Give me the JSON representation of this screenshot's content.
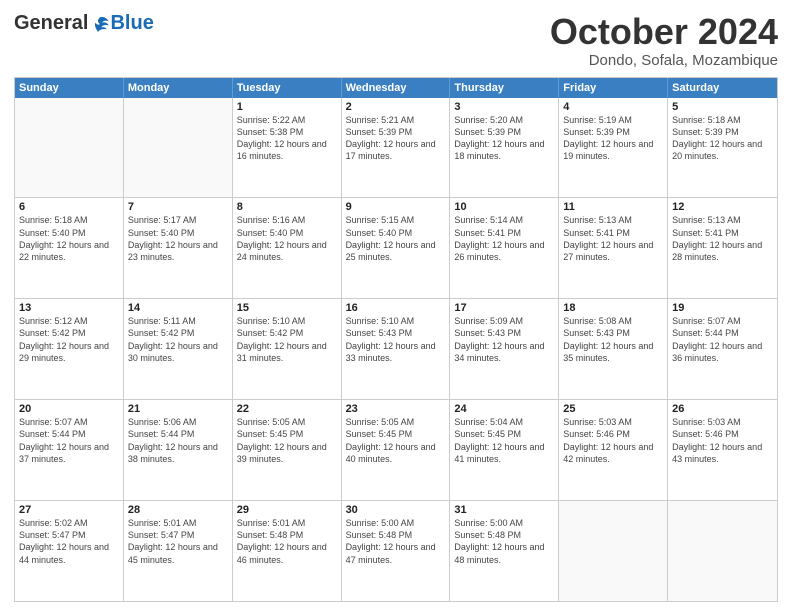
{
  "header": {
    "logo_general": "General",
    "logo_blue": "Blue",
    "month_title": "October 2024",
    "subtitle": "Dondo, Sofala, Mozambique"
  },
  "days_of_week": [
    "Sunday",
    "Monday",
    "Tuesday",
    "Wednesday",
    "Thursday",
    "Friday",
    "Saturday"
  ],
  "weeks": [
    [
      {
        "day": "",
        "empty": true
      },
      {
        "day": "",
        "empty": true
      },
      {
        "day": "1",
        "sunrise": "Sunrise: 5:22 AM",
        "sunset": "Sunset: 5:38 PM",
        "daylight": "Daylight: 12 hours and 16 minutes."
      },
      {
        "day": "2",
        "sunrise": "Sunrise: 5:21 AM",
        "sunset": "Sunset: 5:39 PM",
        "daylight": "Daylight: 12 hours and 17 minutes."
      },
      {
        "day": "3",
        "sunrise": "Sunrise: 5:20 AM",
        "sunset": "Sunset: 5:39 PM",
        "daylight": "Daylight: 12 hours and 18 minutes."
      },
      {
        "day": "4",
        "sunrise": "Sunrise: 5:19 AM",
        "sunset": "Sunset: 5:39 PM",
        "daylight": "Daylight: 12 hours and 19 minutes."
      },
      {
        "day": "5",
        "sunrise": "Sunrise: 5:18 AM",
        "sunset": "Sunset: 5:39 PM",
        "daylight": "Daylight: 12 hours and 20 minutes."
      }
    ],
    [
      {
        "day": "6",
        "sunrise": "Sunrise: 5:18 AM",
        "sunset": "Sunset: 5:40 PM",
        "daylight": "Daylight: 12 hours and 22 minutes."
      },
      {
        "day": "7",
        "sunrise": "Sunrise: 5:17 AM",
        "sunset": "Sunset: 5:40 PM",
        "daylight": "Daylight: 12 hours and 23 minutes."
      },
      {
        "day": "8",
        "sunrise": "Sunrise: 5:16 AM",
        "sunset": "Sunset: 5:40 PM",
        "daylight": "Daylight: 12 hours and 24 minutes."
      },
      {
        "day": "9",
        "sunrise": "Sunrise: 5:15 AM",
        "sunset": "Sunset: 5:40 PM",
        "daylight": "Daylight: 12 hours and 25 minutes."
      },
      {
        "day": "10",
        "sunrise": "Sunrise: 5:14 AM",
        "sunset": "Sunset: 5:41 PM",
        "daylight": "Daylight: 12 hours and 26 minutes."
      },
      {
        "day": "11",
        "sunrise": "Sunrise: 5:13 AM",
        "sunset": "Sunset: 5:41 PM",
        "daylight": "Daylight: 12 hours and 27 minutes."
      },
      {
        "day": "12",
        "sunrise": "Sunrise: 5:13 AM",
        "sunset": "Sunset: 5:41 PM",
        "daylight": "Daylight: 12 hours and 28 minutes."
      }
    ],
    [
      {
        "day": "13",
        "sunrise": "Sunrise: 5:12 AM",
        "sunset": "Sunset: 5:42 PM",
        "daylight": "Daylight: 12 hours and 29 minutes."
      },
      {
        "day": "14",
        "sunrise": "Sunrise: 5:11 AM",
        "sunset": "Sunset: 5:42 PM",
        "daylight": "Daylight: 12 hours and 30 minutes."
      },
      {
        "day": "15",
        "sunrise": "Sunrise: 5:10 AM",
        "sunset": "Sunset: 5:42 PM",
        "daylight": "Daylight: 12 hours and 31 minutes."
      },
      {
        "day": "16",
        "sunrise": "Sunrise: 5:10 AM",
        "sunset": "Sunset: 5:43 PM",
        "daylight": "Daylight: 12 hours and 33 minutes."
      },
      {
        "day": "17",
        "sunrise": "Sunrise: 5:09 AM",
        "sunset": "Sunset: 5:43 PM",
        "daylight": "Daylight: 12 hours and 34 minutes."
      },
      {
        "day": "18",
        "sunrise": "Sunrise: 5:08 AM",
        "sunset": "Sunset: 5:43 PM",
        "daylight": "Daylight: 12 hours and 35 minutes."
      },
      {
        "day": "19",
        "sunrise": "Sunrise: 5:07 AM",
        "sunset": "Sunset: 5:44 PM",
        "daylight": "Daylight: 12 hours and 36 minutes."
      }
    ],
    [
      {
        "day": "20",
        "sunrise": "Sunrise: 5:07 AM",
        "sunset": "Sunset: 5:44 PM",
        "daylight": "Daylight: 12 hours and 37 minutes."
      },
      {
        "day": "21",
        "sunrise": "Sunrise: 5:06 AM",
        "sunset": "Sunset: 5:44 PM",
        "daylight": "Daylight: 12 hours and 38 minutes."
      },
      {
        "day": "22",
        "sunrise": "Sunrise: 5:05 AM",
        "sunset": "Sunset: 5:45 PM",
        "daylight": "Daylight: 12 hours and 39 minutes."
      },
      {
        "day": "23",
        "sunrise": "Sunrise: 5:05 AM",
        "sunset": "Sunset: 5:45 PM",
        "daylight": "Daylight: 12 hours and 40 minutes."
      },
      {
        "day": "24",
        "sunrise": "Sunrise: 5:04 AM",
        "sunset": "Sunset: 5:45 PM",
        "daylight": "Daylight: 12 hours and 41 minutes."
      },
      {
        "day": "25",
        "sunrise": "Sunrise: 5:03 AM",
        "sunset": "Sunset: 5:46 PM",
        "daylight": "Daylight: 12 hours and 42 minutes."
      },
      {
        "day": "26",
        "sunrise": "Sunrise: 5:03 AM",
        "sunset": "Sunset: 5:46 PM",
        "daylight": "Daylight: 12 hours and 43 minutes."
      }
    ],
    [
      {
        "day": "27",
        "sunrise": "Sunrise: 5:02 AM",
        "sunset": "Sunset: 5:47 PM",
        "daylight": "Daylight: 12 hours and 44 minutes."
      },
      {
        "day": "28",
        "sunrise": "Sunrise: 5:01 AM",
        "sunset": "Sunset: 5:47 PM",
        "daylight": "Daylight: 12 hours and 45 minutes."
      },
      {
        "day": "29",
        "sunrise": "Sunrise: 5:01 AM",
        "sunset": "Sunset: 5:48 PM",
        "daylight": "Daylight: 12 hours and 46 minutes."
      },
      {
        "day": "30",
        "sunrise": "Sunrise: 5:00 AM",
        "sunset": "Sunset: 5:48 PM",
        "daylight": "Daylight: 12 hours and 47 minutes."
      },
      {
        "day": "31",
        "sunrise": "Sunrise: 5:00 AM",
        "sunset": "Sunset: 5:48 PM",
        "daylight": "Daylight: 12 hours and 48 minutes."
      },
      {
        "day": "",
        "empty": true
      },
      {
        "day": "",
        "empty": true
      }
    ]
  ]
}
